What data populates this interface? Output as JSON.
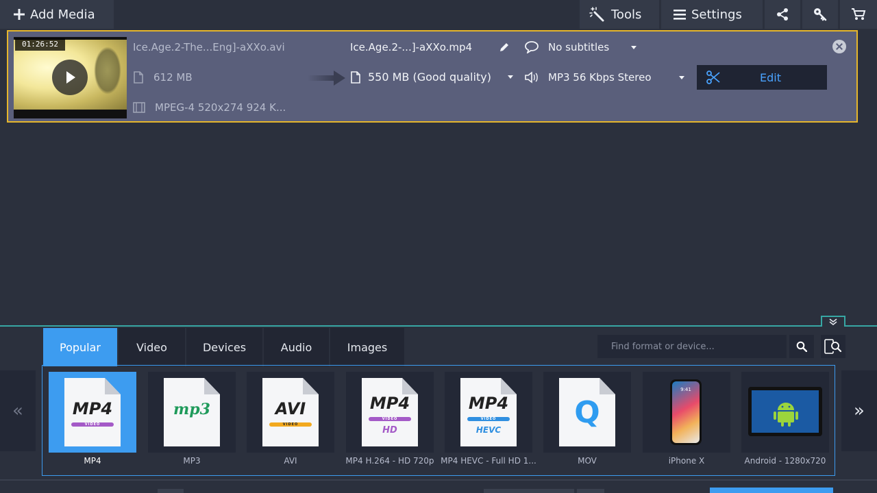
{
  "toolbar": {
    "add_media": "Add Media",
    "tools": "Tools",
    "settings": "Settings"
  },
  "file": {
    "duration": "01:26:52",
    "source_name": "Ice.Age.2-The...Eng]-aXXo.avi",
    "source_size": "612 MB",
    "source_format": "MPEG-4 520x274 924 K...",
    "output_name": "Ice.Age.2-...]-aXXo.mp4",
    "output_size": "550 MB (Good quality)",
    "subtitles": "No subtitles",
    "audio": "MP3 56 Kbps Stereo",
    "edit_label": "Edit"
  },
  "formats_panel": {
    "tabs": [
      "Popular",
      "Video",
      "Devices",
      "Audio",
      "Images"
    ],
    "active_tab": "Popular",
    "search_placeholder": "Find format or device...",
    "prev": "«",
    "next": "»",
    "items": [
      {
        "label": "MP4",
        "icon_text": "MP4",
        "sub": "VIDEO"
      },
      {
        "label": "MP3",
        "icon_text": "mp3"
      },
      {
        "label": "AVI",
        "icon_text": "AVI",
        "sub": "VIDEO"
      },
      {
        "label": "MP4 H.264 - HD 720p",
        "icon_text": "MP4",
        "sub": "VIDEO",
        "extra": "HD"
      },
      {
        "label": "MP4 HEVC - Full HD 1...",
        "icon_text": "MP4",
        "sub": "VIDEO",
        "extra": "HEVC"
      },
      {
        "label": "MOV",
        "icon_text": "Q"
      },
      {
        "label": "iPhone X",
        "icon_text": "9:41"
      },
      {
        "label": "Android - 1280x720"
      }
    ],
    "selected_index": 0
  },
  "colors": {
    "accent": "#3d9cf0",
    "selection_border": "#e6b62b",
    "panel_divider": "#37a7a4"
  }
}
